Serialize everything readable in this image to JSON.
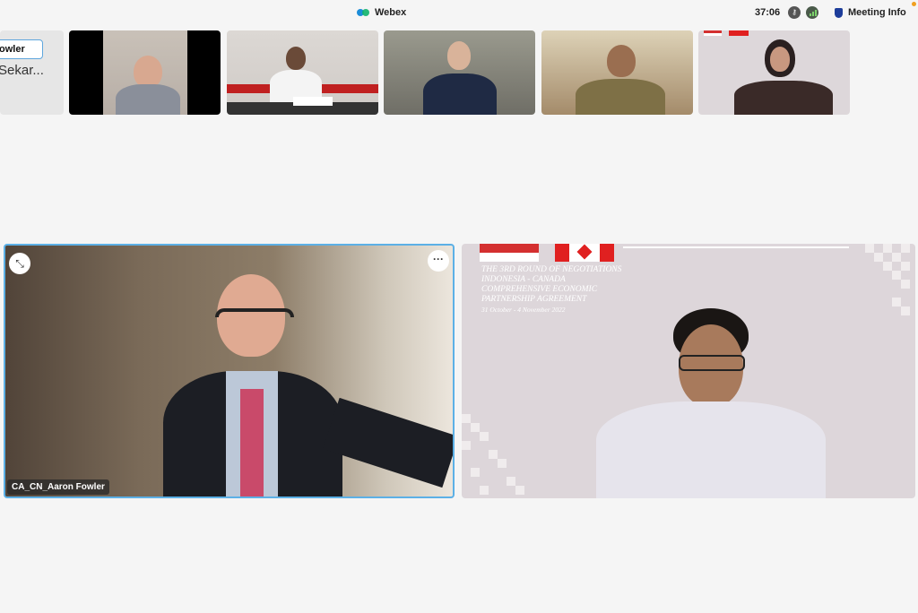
{
  "app": {
    "title": "Webex"
  },
  "header": {
    "timer": "37:06",
    "meeting_info_label": "Meeting Info"
  },
  "thumbnails": [
    {
      "name_pill": "owler",
      "name_sub": "Sekar..."
    }
  ],
  "main_tiles": {
    "left": {
      "participant_name": "CA_CN_Aaron Fowler",
      "more_label": "···"
    },
    "right": {
      "banner_lines": [
        "The 3rd Round of Negotiations",
        "Indonesia - Canada",
        "Comprehensive Economic",
        "Partnership Agreement"
      ],
      "banner_date": "31 October - 4 November 2022"
    }
  },
  "colors": {
    "accent": "#5cb0e6",
    "background": "#f5f5f5"
  }
}
